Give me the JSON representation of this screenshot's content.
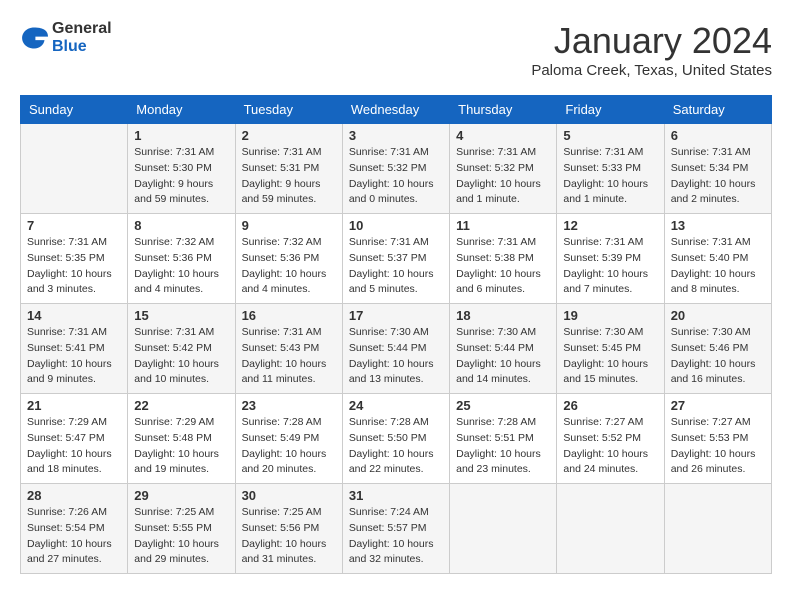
{
  "header": {
    "logo_general": "General",
    "logo_blue": "Blue",
    "month": "January 2024",
    "location": "Paloma Creek, Texas, United States"
  },
  "days_of_week": [
    "Sunday",
    "Monday",
    "Tuesday",
    "Wednesday",
    "Thursday",
    "Friday",
    "Saturday"
  ],
  "weeks": [
    [
      {
        "num": "",
        "info": ""
      },
      {
        "num": "1",
        "info": "Sunrise: 7:31 AM\nSunset: 5:30 PM\nDaylight: 9 hours\nand 59 minutes."
      },
      {
        "num": "2",
        "info": "Sunrise: 7:31 AM\nSunset: 5:31 PM\nDaylight: 9 hours\nand 59 minutes."
      },
      {
        "num": "3",
        "info": "Sunrise: 7:31 AM\nSunset: 5:32 PM\nDaylight: 10 hours\nand 0 minutes."
      },
      {
        "num": "4",
        "info": "Sunrise: 7:31 AM\nSunset: 5:32 PM\nDaylight: 10 hours\nand 1 minute."
      },
      {
        "num": "5",
        "info": "Sunrise: 7:31 AM\nSunset: 5:33 PM\nDaylight: 10 hours\nand 1 minute."
      },
      {
        "num": "6",
        "info": "Sunrise: 7:31 AM\nSunset: 5:34 PM\nDaylight: 10 hours\nand 2 minutes."
      }
    ],
    [
      {
        "num": "7",
        "info": "Sunrise: 7:31 AM\nSunset: 5:35 PM\nDaylight: 10 hours\nand 3 minutes."
      },
      {
        "num": "8",
        "info": "Sunrise: 7:32 AM\nSunset: 5:36 PM\nDaylight: 10 hours\nand 4 minutes."
      },
      {
        "num": "9",
        "info": "Sunrise: 7:32 AM\nSunset: 5:36 PM\nDaylight: 10 hours\nand 4 minutes."
      },
      {
        "num": "10",
        "info": "Sunrise: 7:31 AM\nSunset: 5:37 PM\nDaylight: 10 hours\nand 5 minutes."
      },
      {
        "num": "11",
        "info": "Sunrise: 7:31 AM\nSunset: 5:38 PM\nDaylight: 10 hours\nand 6 minutes."
      },
      {
        "num": "12",
        "info": "Sunrise: 7:31 AM\nSunset: 5:39 PM\nDaylight: 10 hours\nand 7 minutes."
      },
      {
        "num": "13",
        "info": "Sunrise: 7:31 AM\nSunset: 5:40 PM\nDaylight: 10 hours\nand 8 minutes."
      }
    ],
    [
      {
        "num": "14",
        "info": "Sunrise: 7:31 AM\nSunset: 5:41 PM\nDaylight: 10 hours\nand 9 minutes."
      },
      {
        "num": "15",
        "info": "Sunrise: 7:31 AM\nSunset: 5:42 PM\nDaylight: 10 hours\nand 10 minutes."
      },
      {
        "num": "16",
        "info": "Sunrise: 7:31 AM\nSunset: 5:43 PM\nDaylight: 10 hours\nand 11 minutes."
      },
      {
        "num": "17",
        "info": "Sunrise: 7:30 AM\nSunset: 5:44 PM\nDaylight: 10 hours\nand 13 minutes."
      },
      {
        "num": "18",
        "info": "Sunrise: 7:30 AM\nSunset: 5:44 PM\nDaylight: 10 hours\nand 14 minutes."
      },
      {
        "num": "19",
        "info": "Sunrise: 7:30 AM\nSunset: 5:45 PM\nDaylight: 10 hours\nand 15 minutes."
      },
      {
        "num": "20",
        "info": "Sunrise: 7:30 AM\nSunset: 5:46 PM\nDaylight: 10 hours\nand 16 minutes."
      }
    ],
    [
      {
        "num": "21",
        "info": "Sunrise: 7:29 AM\nSunset: 5:47 PM\nDaylight: 10 hours\nand 18 minutes."
      },
      {
        "num": "22",
        "info": "Sunrise: 7:29 AM\nSunset: 5:48 PM\nDaylight: 10 hours\nand 19 minutes."
      },
      {
        "num": "23",
        "info": "Sunrise: 7:28 AM\nSunset: 5:49 PM\nDaylight: 10 hours\nand 20 minutes."
      },
      {
        "num": "24",
        "info": "Sunrise: 7:28 AM\nSunset: 5:50 PM\nDaylight: 10 hours\nand 22 minutes."
      },
      {
        "num": "25",
        "info": "Sunrise: 7:28 AM\nSunset: 5:51 PM\nDaylight: 10 hours\nand 23 minutes."
      },
      {
        "num": "26",
        "info": "Sunrise: 7:27 AM\nSunset: 5:52 PM\nDaylight: 10 hours\nand 24 minutes."
      },
      {
        "num": "27",
        "info": "Sunrise: 7:27 AM\nSunset: 5:53 PM\nDaylight: 10 hours\nand 26 minutes."
      }
    ],
    [
      {
        "num": "28",
        "info": "Sunrise: 7:26 AM\nSunset: 5:54 PM\nDaylight: 10 hours\nand 27 minutes."
      },
      {
        "num": "29",
        "info": "Sunrise: 7:25 AM\nSunset: 5:55 PM\nDaylight: 10 hours\nand 29 minutes."
      },
      {
        "num": "30",
        "info": "Sunrise: 7:25 AM\nSunset: 5:56 PM\nDaylight: 10 hours\nand 31 minutes."
      },
      {
        "num": "31",
        "info": "Sunrise: 7:24 AM\nSunset: 5:57 PM\nDaylight: 10 hours\nand 32 minutes."
      },
      {
        "num": "",
        "info": ""
      },
      {
        "num": "",
        "info": ""
      },
      {
        "num": "",
        "info": ""
      }
    ]
  ]
}
